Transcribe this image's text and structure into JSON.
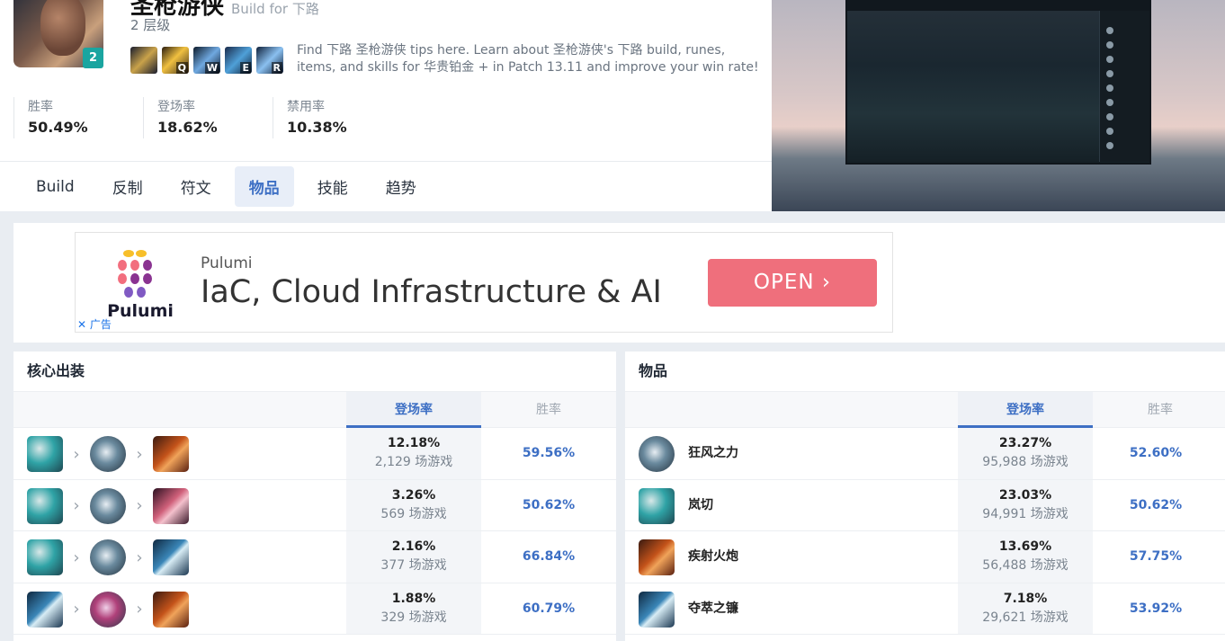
{
  "header": {
    "champion_name": "圣枪游侠",
    "build_for": "Build for 下路",
    "tier": "2 层级",
    "tier_badge": "2",
    "description": "Find 下路 圣枪游侠 tips here. Learn about 圣枪游侠's 下路 build, runes, items, and skills for 华贵铂金 + in Patch 13.11 and improve your win rate!",
    "skills": [
      {
        "key": ""
      },
      {
        "key": "Q"
      },
      {
        "key": "W"
      },
      {
        "key": "E"
      },
      {
        "key": "R"
      }
    ],
    "stats": [
      {
        "label": "胜率",
        "value": "50.49%"
      },
      {
        "label": "登场率",
        "value": "18.62%"
      },
      {
        "label": "禁用率",
        "value": "10.38%"
      }
    ],
    "tabs": [
      "Build",
      "反制",
      "符文",
      "物品",
      "技能",
      "趋势"
    ],
    "active_tab": "物品"
  },
  "ad": {
    "brand": "Pulumi",
    "small": "Pulumi",
    "headline": "IaC, Cloud Infrastructure & AI",
    "button": "OPEN",
    "close_label": "广告"
  },
  "core_builds": {
    "title": "核心出装",
    "col_pick": "登场率",
    "col_win": "胜率",
    "rows": [
      {
        "icons": [
          "ic1",
          "ic2",
          "ic3"
        ],
        "pick": "12.18%",
        "games": "2,129 场游戏",
        "win": "59.56%"
      },
      {
        "icons": [
          "ic1",
          "ic2",
          "ic4"
        ],
        "pick": "3.26%",
        "games": "569 场游戏",
        "win": "50.62%"
      },
      {
        "icons": [
          "ic1",
          "ic2",
          "ic5"
        ],
        "pick": "2.16%",
        "games": "377 场游戏",
        "win": "66.84%"
      },
      {
        "icons": [
          "ic5",
          "ic6",
          "ic3"
        ],
        "pick": "1.88%",
        "games": "329 场游戏",
        "win": "60.79%"
      }
    ]
  },
  "items": {
    "title": "物品",
    "col_pick": "登场率",
    "col_win": "胜率",
    "rows": [
      {
        "icon": "ic2",
        "name": "狂风之力",
        "pick": "23.27%",
        "games": "95,988 场游戏",
        "win": "52.60%"
      },
      {
        "icon": "ic1",
        "name": "岚切",
        "pick": "23.03%",
        "games": "94,991 场游戏",
        "win": "50.62%"
      },
      {
        "icon": "ic3",
        "name": "疾射火炮",
        "pick": "13.69%",
        "games": "56,488 场游戏",
        "win": "57.75%"
      },
      {
        "icon": "ic5",
        "name": "夺萃之镰",
        "pick": "7.18%",
        "games": "29,621 场游戏",
        "win": "53.92%"
      }
    ]
  }
}
